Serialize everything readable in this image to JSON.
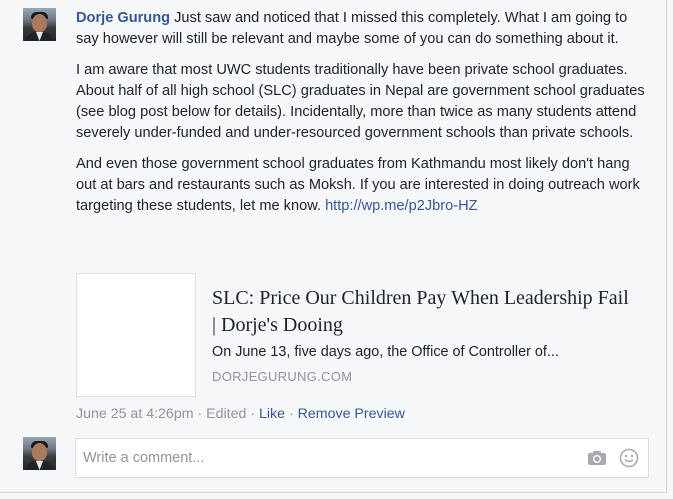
{
  "comment": {
    "author": "Dorje Gurung",
    "paragraphs": [
      " Just saw and noticed that I missed this completely. What I am going to say however will still be relevant and maybe some of you can do something about it.",
      "I am aware that most UWC students traditionally have been private school graduates. About half of all high school (SLC) graduates in Nepal are government school graduates (see blog post below for details). Incidentally, more than twice as many students attend severely under-funded and under-resourced government schools than private schools.",
      "And even those government school graduates from Kathmandu most likely don't hang out at bars and restaurants such as Moksh. If you are interested in doing outreach work targeting these students, let me know. "
    ],
    "link_text": "http://wp.me/p2Jbro-HZ"
  },
  "link_preview": {
    "title": "SLC: Price Our Children Pay When Leadership Fail | Dorje's Dooing",
    "description": "On June 13, five days ago, the Office of Controller of...",
    "domain": "DORJEGURUNG.COM"
  },
  "meta": {
    "timestamp": "June 25 at 4:26pm",
    "sep1": " · ",
    "edited": "Edited",
    "sep2": " · ",
    "like": "Like",
    "sep3": " · ",
    "remove_preview": "Remove Preview"
  },
  "reply": {
    "placeholder": "Write a comment...",
    "camera_icon": "camera-icon",
    "emoji_icon": "smiley-icon"
  },
  "colors": {
    "link": "#365899",
    "muted": "#90949c",
    "background": "#f6f7f9"
  }
}
